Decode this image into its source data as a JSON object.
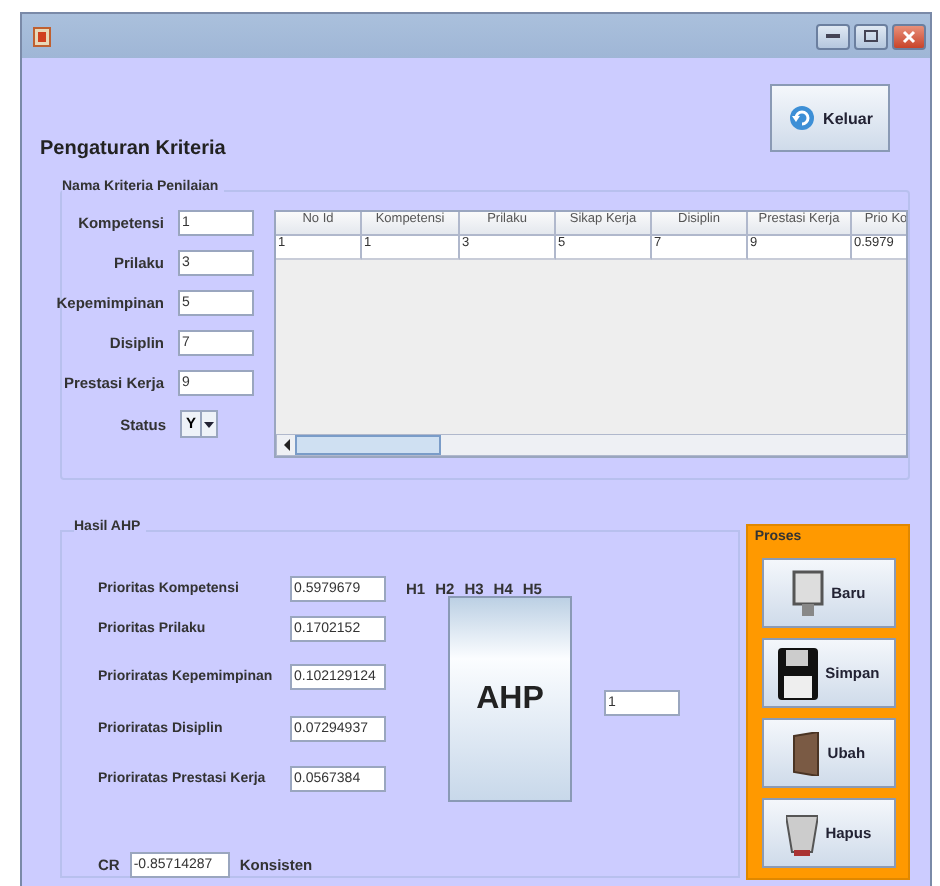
{
  "header": {
    "title": "Pengaturan Kriteria",
    "exit_button": "Keluar"
  },
  "criteria_group": {
    "title": "Nama Kriteria Penilaian",
    "fields": [
      {
        "label": "Kompetensi",
        "value": "1"
      },
      {
        "label": "Prilaku",
        "value": "3"
      },
      {
        "label": "Kepemimpinan",
        "value": "5"
      },
      {
        "label": "Disiplin",
        "value": "7"
      },
      {
        "label": "Prestasi Kerja",
        "value": "9"
      }
    ],
    "status": {
      "label": "Status",
      "value": "Y"
    }
  },
  "table": {
    "columns": [
      "No Id",
      "Kompetensi",
      "Prilaku",
      "Sikap Kerja",
      "Disiplin",
      "Prestasi Kerja",
      "Prio Ko"
    ],
    "rows": [
      [
        "1",
        "1",
        "3",
        "5",
        "7",
        "9",
        "0.5979"
      ]
    ]
  },
  "result_group": {
    "title": "Hasil AHP",
    "fields": [
      {
        "label": "Prioritas Kompetensi",
        "value": "0.5979679"
      },
      {
        "label": "Prioritas Prilaku",
        "value": "0.1702152"
      },
      {
        "label": "Prioriratas Kepemimpinan",
        "value": "0.102129124"
      },
      {
        "label": "Prioriratas Disiplin",
        "value": "0.07294937"
      },
      {
        "label": "Prioriratas Prestasi Kerja",
        "value": "0.0567384"
      }
    ],
    "headers": [
      "H1",
      "H2",
      "H3",
      "H4",
      "H5"
    ],
    "ahp_button": "AHP",
    "side_field": "1",
    "cr": {
      "label": "CR",
      "value": "-0.85714287",
      "verdict": "Konsisten"
    }
  },
  "process": {
    "title": "Proses",
    "buttons": [
      {
        "label": "Baru",
        "kind": "new"
      },
      {
        "label": "Simpan",
        "kind": "save"
      },
      {
        "label": "Ubah",
        "kind": "edit"
      },
      {
        "label": "Hapus",
        "kind": "delete"
      }
    ]
  }
}
